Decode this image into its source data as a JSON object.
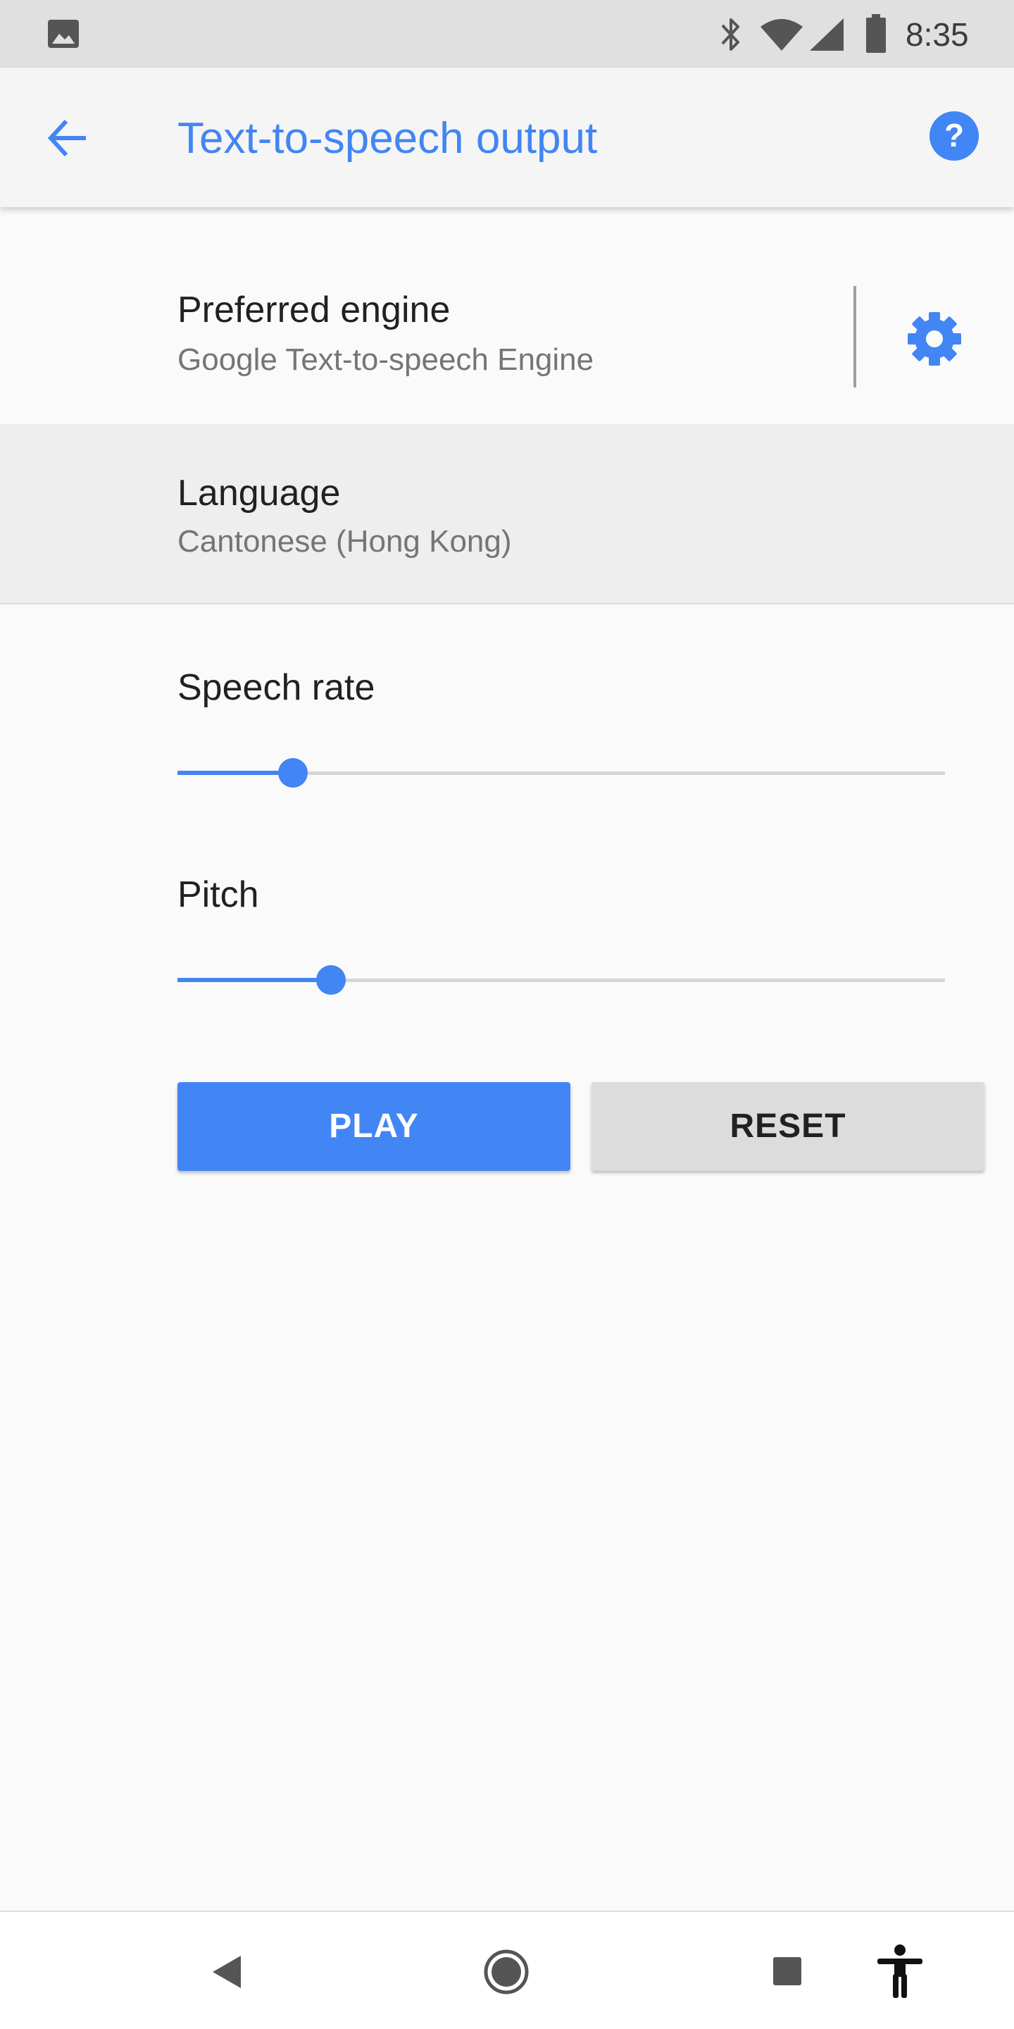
{
  "status_bar": {
    "time": "8:35",
    "icons": [
      "image-notification-icon",
      "bluetooth-icon",
      "wifi-icon",
      "cell-signal-icon",
      "battery-icon"
    ]
  },
  "app_bar": {
    "title": "Text-to-speech output",
    "back_icon": "arrow-back-icon",
    "help_icon": "help-icon"
  },
  "settings": {
    "engine": {
      "label": "Preferred engine",
      "value": "Google Text-to-speech Engine",
      "settings_icon": "gear-icon"
    },
    "language": {
      "label": "Language",
      "value": "Cantonese (Hong Kong)"
    },
    "speech_rate": {
      "label": "Speech rate",
      "level": 0.15
    },
    "pitch": {
      "label": "Pitch",
      "level": 0.2
    }
  },
  "buttons": {
    "play": "PLAY",
    "reset": "RESET"
  },
  "nav_bar": {
    "icons": [
      "nav-back-icon",
      "nav-home-icon",
      "nav-recents-icon",
      "accessibility-icon"
    ]
  },
  "colors": {
    "accent": "#4285f4",
    "status_bar_bg": "#e0e0e0",
    "app_bar_bg": "#f5f5f5",
    "selected_row_bg": "#eeeeee",
    "reset_button_bg": "#dcdcdc"
  }
}
